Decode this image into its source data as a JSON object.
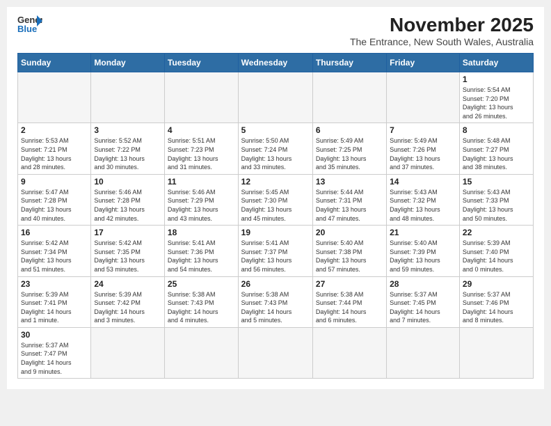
{
  "header": {
    "logo_line1": "General",
    "logo_line2": "Blue",
    "title": "November 2025",
    "subtitle": "The Entrance, New South Wales, Australia"
  },
  "weekdays": [
    "Sunday",
    "Monday",
    "Tuesday",
    "Wednesday",
    "Thursday",
    "Friday",
    "Saturday"
  ],
  "weeks": [
    [
      {
        "day": "",
        "info": ""
      },
      {
        "day": "",
        "info": ""
      },
      {
        "day": "",
        "info": ""
      },
      {
        "day": "",
        "info": ""
      },
      {
        "day": "",
        "info": ""
      },
      {
        "day": "",
        "info": ""
      },
      {
        "day": "1",
        "info": "Sunrise: 5:54 AM\nSunset: 7:20 PM\nDaylight: 13 hours\nand 26 minutes."
      }
    ],
    [
      {
        "day": "2",
        "info": "Sunrise: 5:53 AM\nSunset: 7:21 PM\nDaylight: 13 hours\nand 28 minutes."
      },
      {
        "day": "3",
        "info": "Sunrise: 5:52 AM\nSunset: 7:22 PM\nDaylight: 13 hours\nand 30 minutes."
      },
      {
        "day": "4",
        "info": "Sunrise: 5:51 AM\nSunset: 7:23 PM\nDaylight: 13 hours\nand 31 minutes."
      },
      {
        "day": "5",
        "info": "Sunrise: 5:50 AM\nSunset: 7:24 PM\nDaylight: 13 hours\nand 33 minutes."
      },
      {
        "day": "6",
        "info": "Sunrise: 5:49 AM\nSunset: 7:25 PM\nDaylight: 13 hours\nand 35 minutes."
      },
      {
        "day": "7",
        "info": "Sunrise: 5:49 AM\nSunset: 7:26 PM\nDaylight: 13 hours\nand 37 minutes."
      },
      {
        "day": "8",
        "info": "Sunrise: 5:48 AM\nSunset: 7:27 PM\nDaylight: 13 hours\nand 38 minutes."
      }
    ],
    [
      {
        "day": "9",
        "info": "Sunrise: 5:47 AM\nSunset: 7:28 PM\nDaylight: 13 hours\nand 40 minutes."
      },
      {
        "day": "10",
        "info": "Sunrise: 5:46 AM\nSunset: 7:28 PM\nDaylight: 13 hours\nand 42 minutes."
      },
      {
        "day": "11",
        "info": "Sunrise: 5:46 AM\nSunset: 7:29 PM\nDaylight: 13 hours\nand 43 minutes."
      },
      {
        "day": "12",
        "info": "Sunrise: 5:45 AM\nSunset: 7:30 PM\nDaylight: 13 hours\nand 45 minutes."
      },
      {
        "day": "13",
        "info": "Sunrise: 5:44 AM\nSunset: 7:31 PM\nDaylight: 13 hours\nand 47 minutes."
      },
      {
        "day": "14",
        "info": "Sunrise: 5:43 AM\nSunset: 7:32 PM\nDaylight: 13 hours\nand 48 minutes."
      },
      {
        "day": "15",
        "info": "Sunrise: 5:43 AM\nSunset: 7:33 PM\nDaylight: 13 hours\nand 50 minutes."
      }
    ],
    [
      {
        "day": "16",
        "info": "Sunrise: 5:42 AM\nSunset: 7:34 PM\nDaylight: 13 hours\nand 51 minutes."
      },
      {
        "day": "17",
        "info": "Sunrise: 5:42 AM\nSunset: 7:35 PM\nDaylight: 13 hours\nand 53 minutes."
      },
      {
        "day": "18",
        "info": "Sunrise: 5:41 AM\nSunset: 7:36 PM\nDaylight: 13 hours\nand 54 minutes."
      },
      {
        "day": "19",
        "info": "Sunrise: 5:41 AM\nSunset: 7:37 PM\nDaylight: 13 hours\nand 56 minutes."
      },
      {
        "day": "20",
        "info": "Sunrise: 5:40 AM\nSunset: 7:38 PM\nDaylight: 13 hours\nand 57 minutes."
      },
      {
        "day": "21",
        "info": "Sunrise: 5:40 AM\nSunset: 7:39 PM\nDaylight: 13 hours\nand 59 minutes."
      },
      {
        "day": "22",
        "info": "Sunrise: 5:39 AM\nSunset: 7:40 PM\nDaylight: 14 hours\nand 0 minutes."
      }
    ],
    [
      {
        "day": "23",
        "info": "Sunrise: 5:39 AM\nSunset: 7:41 PM\nDaylight: 14 hours\nand 1 minute."
      },
      {
        "day": "24",
        "info": "Sunrise: 5:39 AM\nSunset: 7:42 PM\nDaylight: 14 hours\nand 3 minutes."
      },
      {
        "day": "25",
        "info": "Sunrise: 5:38 AM\nSunset: 7:43 PM\nDaylight: 14 hours\nand 4 minutes."
      },
      {
        "day": "26",
        "info": "Sunrise: 5:38 AM\nSunset: 7:43 PM\nDaylight: 14 hours\nand 5 minutes."
      },
      {
        "day": "27",
        "info": "Sunrise: 5:38 AM\nSunset: 7:44 PM\nDaylight: 14 hours\nand 6 minutes."
      },
      {
        "day": "28",
        "info": "Sunrise: 5:37 AM\nSunset: 7:45 PM\nDaylight: 14 hours\nand 7 minutes."
      },
      {
        "day": "29",
        "info": "Sunrise: 5:37 AM\nSunset: 7:46 PM\nDaylight: 14 hours\nand 8 minutes."
      }
    ],
    [
      {
        "day": "30",
        "info": "Sunrise: 5:37 AM\nSunset: 7:47 PM\nDaylight: 14 hours\nand 9 minutes."
      },
      {
        "day": "",
        "info": ""
      },
      {
        "day": "",
        "info": ""
      },
      {
        "day": "",
        "info": ""
      },
      {
        "day": "",
        "info": ""
      },
      {
        "day": "",
        "info": ""
      },
      {
        "day": "",
        "info": ""
      }
    ]
  ]
}
